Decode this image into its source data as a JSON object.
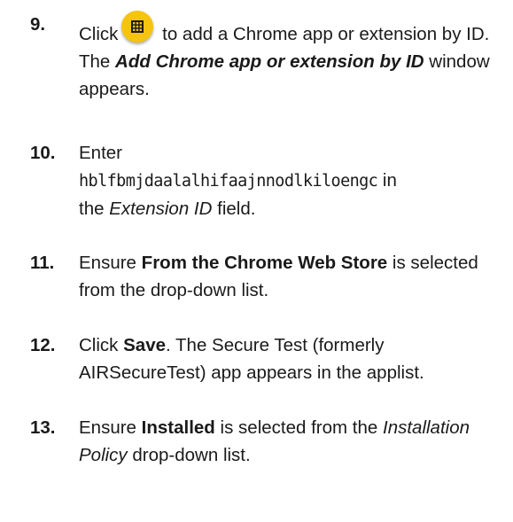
{
  "steps": [
    {
      "number": "9.",
      "parts": {
        "click": "Click",
        "rest1": "to add a Chrome app or extension by ID. The",
        "bolditalic": "Add Chrome app or extension by ID",
        "rest2": "window appears."
      },
      "icon": "apps-grid-icon",
      "icon_color": "#f6c40f"
    },
    {
      "number": "10.",
      "parts": {
        "enter": "Enter",
        "extension_id": "hblfbmjdaalalhifaajnnodlkiloengc",
        "in": "in",
        "the": "the",
        "field_name": "Extension ID",
        "field": "field."
      }
    },
    {
      "number": "11.",
      "parts": {
        "ensure": "Ensure",
        "bold": "From the Chrome Web Store",
        "rest": "is selected from the drop-down list."
      }
    },
    {
      "number": "12.",
      "parts": {
        "click": "Click",
        "bold": "Save",
        "rest": ". The Secure Test (formerly AIRSecureTest) app appears in the applist."
      }
    },
    {
      "number": "13.",
      "parts": {
        "ensure": "Ensure",
        "bold": "Installed",
        "rest1": "is selected from the",
        "italic": "Installation Policy",
        "rest2": "drop-down list."
      }
    }
  ]
}
